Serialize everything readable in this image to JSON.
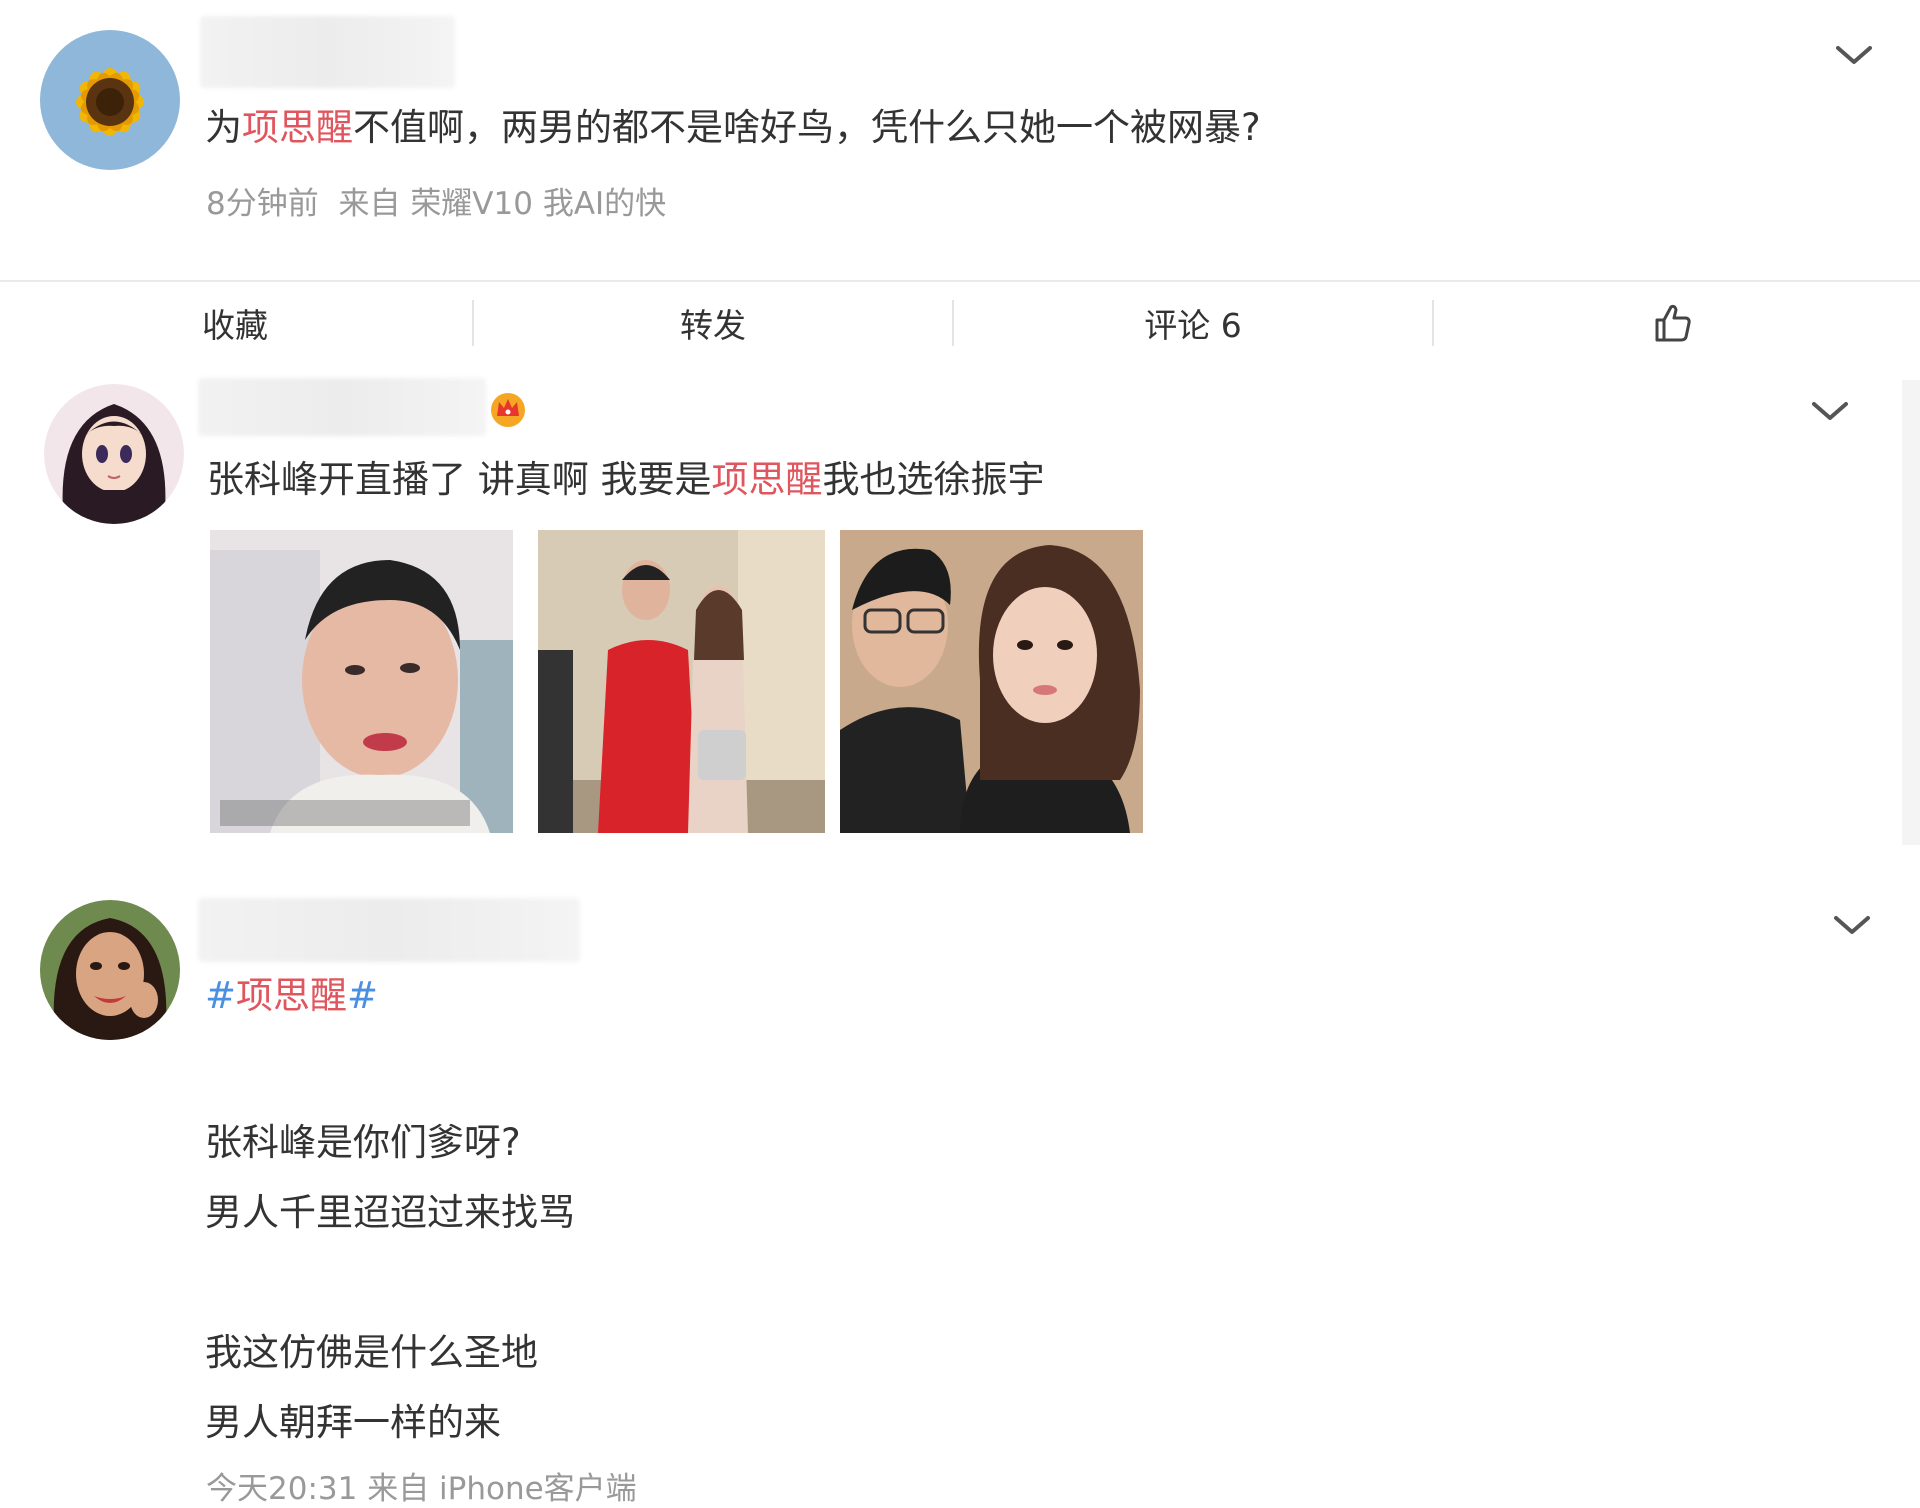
{
  "posts": [
    {
      "text_prefix": "为",
      "text_highlight": "项思醒",
      "text_suffix": "不值啊，两男的都不是啥好鸟，凭什么只她一个被网暴?",
      "time": "8分钟前",
      "source_label": "来自",
      "source": "荣耀V10 我AI的快",
      "avatar_icon": "sunflower-avatar"
    },
    {
      "text_prefix": "张科峰开直播了 讲真啊 我要是",
      "text_highlight": "项思醒",
      "text_suffix": "我也选徐振宇",
      "badge_icon": "crown-icon",
      "avatar_icon": "anime-girl-avatar",
      "images": [
        "livestream-selfie-thumbnail",
        "red-suit-couple-thumbnail",
        "couple-selfie-thumbnail"
      ]
    },
    {
      "hashtag_open": "#",
      "hashtag": "项思醒",
      "hashtag_close": "#",
      "lines": [
        "张科峰是你们爹呀?",
        "男人千里迢迢过来找骂",
        "我这仿佛是什么圣地",
        "男人朝拜一样的来"
      ],
      "footer_partial": "今天20:31 来自 iPhone客户端",
      "avatar_icon": "woman-avatar"
    }
  ],
  "actions": {
    "favorite": "收藏",
    "repost": "转发",
    "comment": "评论 6",
    "like_icon": "thumbs-up-icon"
  },
  "colors": {
    "highlight": "#e0565e",
    "hashtag": "#4a90e2",
    "meta": "#999999"
  }
}
